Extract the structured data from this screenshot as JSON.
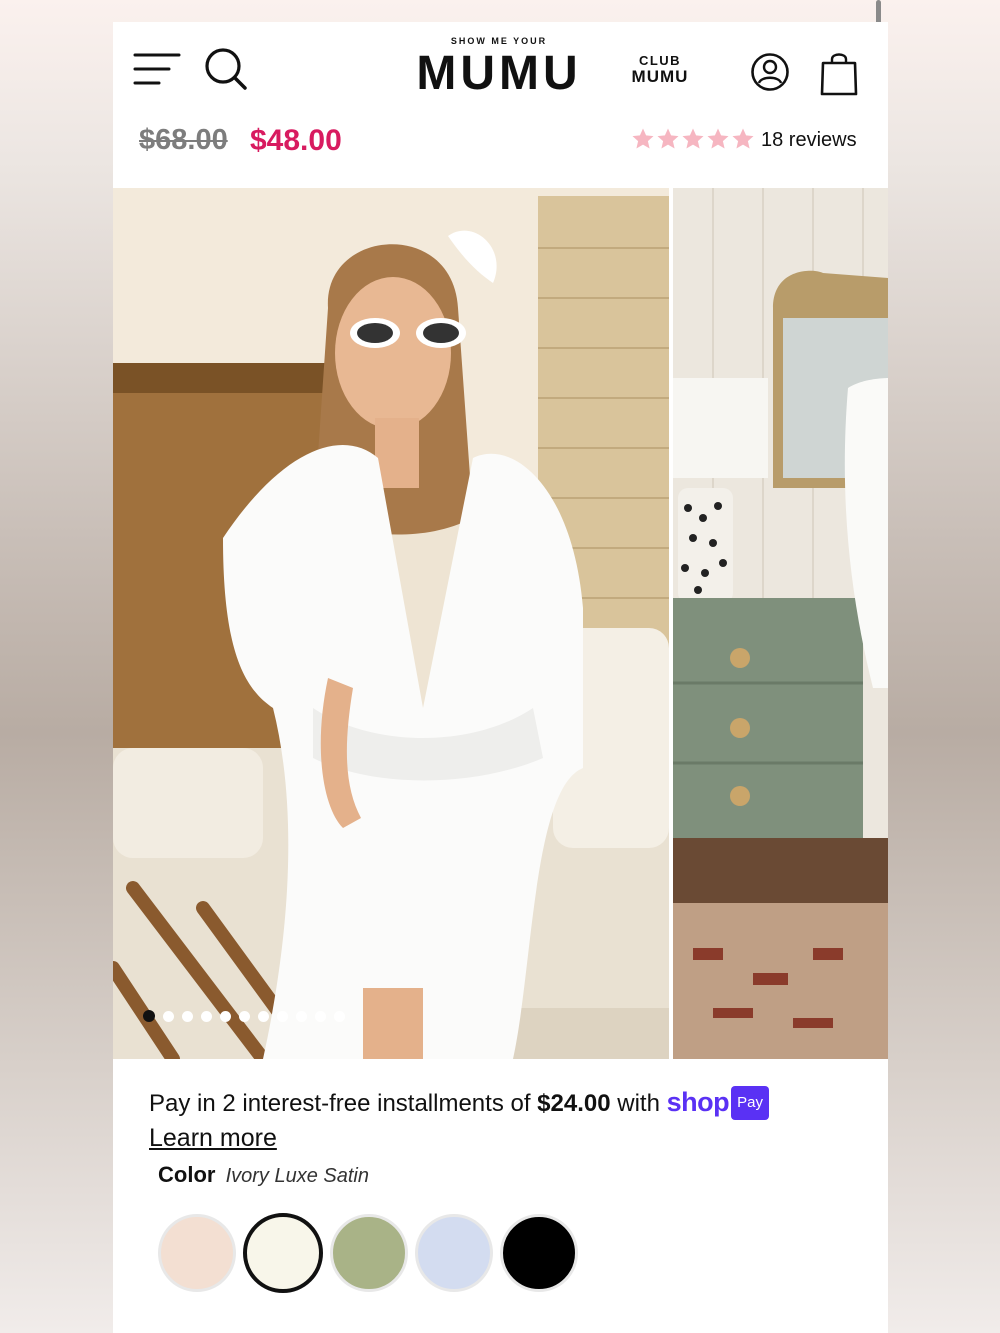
{
  "header": {
    "logo_tagline": "SHOW ME YOUR",
    "logo_text": "MUMU",
    "club_top": "CLUB",
    "club_bottom": "MUMU",
    "icons": [
      "menu-icon",
      "search-icon",
      "account-icon",
      "bag-icon"
    ]
  },
  "price": {
    "original": "$68.00",
    "sale": "$48.00",
    "sale_color": "#d81b60",
    "rating_stars": 5,
    "star_color": "#f6b6c1",
    "reviews_label": "18 reviews"
  },
  "gallery": {
    "total_images": 11,
    "active_index": 0
  },
  "installments": {
    "text_before": "Pay in 2 interest-free installments of ",
    "amount": "$24.00",
    "text_after": " with ",
    "shop_logo": "shop",
    "shop_pay_badge": "Pay",
    "learn_more": "Learn more"
  },
  "color": {
    "label": "Color",
    "selected": "Ivory Luxe Satin",
    "swatches": [
      {
        "color": "#f3dfd2",
        "selected": false
      },
      {
        "color": "#f8f6ea",
        "selected": true
      },
      {
        "color": "#a9b387",
        "selected": false
      },
      {
        "color": "#d3dcf0",
        "selected": false
      },
      {
        "color": "#000000",
        "selected": false
      }
    ]
  }
}
